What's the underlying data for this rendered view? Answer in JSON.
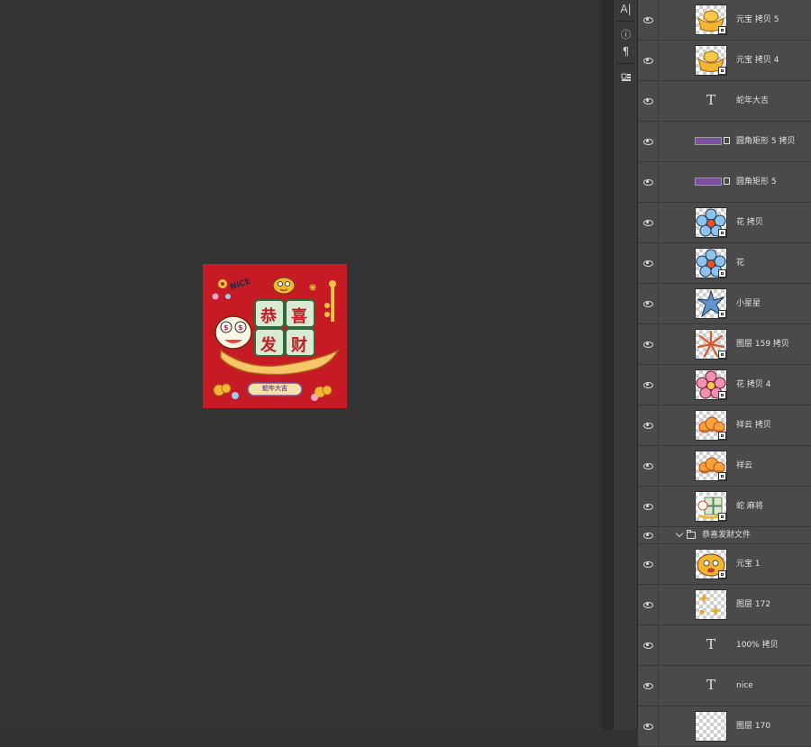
{
  "tool_strip": {
    "char_icon": "A|",
    "info_icon": "ⓘ",
    "paragraph_icon": "¶"
  },
  "artwork": {
    "title_chars": [
      "恭",
      "喜",
      "发",
      "财"
    ],
    "banner": "蛇年大吉",
    "nice_text": "NICE",
    "background_color": "#c61b24"
  },
  "layers": [
    {
      "name": "元宝 拷贝 5",
      "kind": "smart",
      "thumb": "ingot"
    },
    {
      "name": "元宝 拷贝 4",
      "kind": "smart",
      "thumb": "ingot"
    },
    {
      "name": "蛇年大吉",
      "kind": "text"
    },
    {
      "name": "圆角矩形 5 拷贝",
      "kind": "shape"
    },
    {
      "name": "圆角矩形 5",
      "kind": "shape"
    },
    {
      "name": "花 拷贝",
      "kind": "smart",
      "thumb": "blue-flower"
    },
    {
      "name": "花",
      "kind": "smart",
      "thumb": "blue-flower"
    },
    {
      "name": "小星星",
      "kind": "smart",
      "thumb": "star"
    },
    {
      "name": "图层 159 拷贝",
      "kind": "smart",
      "thumb": "burst"
    },
    {
      "name": "花 拷贝 4",
      "kind": "smart",
      "thumb": "pink-flower"
    },
    {
      "name": "祥云 拷贝",
      "kind": "smart",
      "thumb": "cloud"
    },
    {
      "name": "祥云",
      "kind": "smart",
      "thumb": "cloud"
    },
    {
      "name": "蛇 麻将",
      "kind": "smart",
      "thumb": "snake"
    }
  ],
  "group": {
    "name": "恭喜发财文件"
  },
  "group_layers": [
    {
      "name": "元宝 1",
      "kind": "smart",
      "thumb": "ingot-face"
    },
    {
      "name": "图层 172",
      "kind": "raster",
      "thumb": "sparks"
    },
    {
      "name": "100% 拷贝",
      "kind": "text"
    },
    {
      "name": "nice",
      "kind": "text"
    },
    {
      "name": "图层 170",
      "kind": "raster",
      "thumb": "blank"
    }
  ],
  "colors": {
    "canvas_bg": "#333333",
    "panel_bg": "#4a4a4a",
    "artwork_red": "#c61b24",
    "gold": "#f2b632",
    "shape_purple": "#7b4ea0"
  }
}
